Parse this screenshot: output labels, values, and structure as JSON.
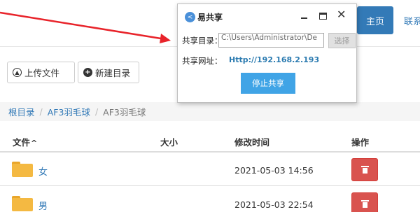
{
  "nav": {
    "home_label": "主页",
    "contact_label": "联系"
  },
  "toolbar": {
    "upload_label": "上传文件",
    "new_dir_label": "新建目录"
  },
  "breadcrumb": {
    "items": [
      "根目录",
      "AF3羽毛球",
      "AF3羽毛球"
    ]
  },
  "table": {
    "headers": {
      "name": "文件",
      "sort_indicator": "^",
      "size": "大小",
      "modified": "修改时间",
      "ops": "操作"
    },
    "rows": [
      {
        "name": "女",
        "size": "",
        "modified": "2021-05-03 14:56"
      },
      {
        "name": "男",
        "size": "",
        "modified": "2021-05-03 22:54"
      }
    ]
  },
  "dialog": {
    "title": "易共享",
    "dir_label": "共享目录：",
    "dir_value": "C:\\Users\\Administrator\\De",
    "choose_label": "选择",
    "url_label": "共享网址：",
    "url_value": "Http://192.168.2.193",
    "stop_label": "停止共享"
  },
  "icons": {
    "dialog_app": "share-icon",
    "upload": "arrow-up-circle-icon",
    "new_dir": "plus-circle-icon",
    "folder": "folder-icon",
    "delete": "trash-icon"
  },
  "colors": {
    "primary": "#337ab7",
    "danger": "#d9534f",
    "folder": "#f4b942",
    "stop_button": "#40a4e6",
    "annotation_arrow": "#e8232a"
  }
}
